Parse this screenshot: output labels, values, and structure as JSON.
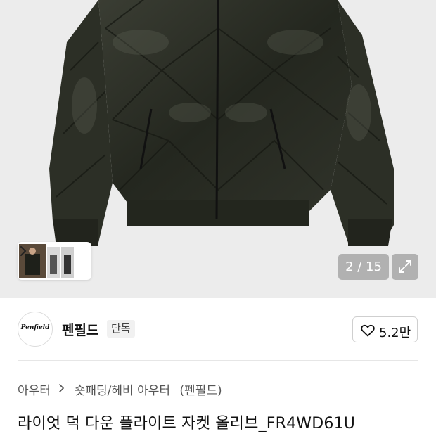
{
  "gallery": {
    "current": "2 / 15",
    "main_image": "olive-quilted-puffer-jacket",
    "thumbnails": [
      "model-wearing-jacket",
      "model-pair-front",
      "model-pair-back"
    ]
  },
  "brand": {
    "logo_text": "Penfield",
    "name": "펜필드",
    "badge": "단독"
  },
  "like": {
    "count": "5.2만"
  },
  "breadcrumb": {
    "category": "아우터",
    "subcategory": "숏패딩/헤비 아우터",
    "brand_suffix": "(펜필드)"
  },
  "product": {
    "title": "라이엇 덕 다운 플라이트 자켓 올리브_FR4WD61U"
  },
  "colors": {
    "hero_bg": "#ececec",
    "jacket": "#2b2e25",
    "accent_text": "#111111"
  }
}
